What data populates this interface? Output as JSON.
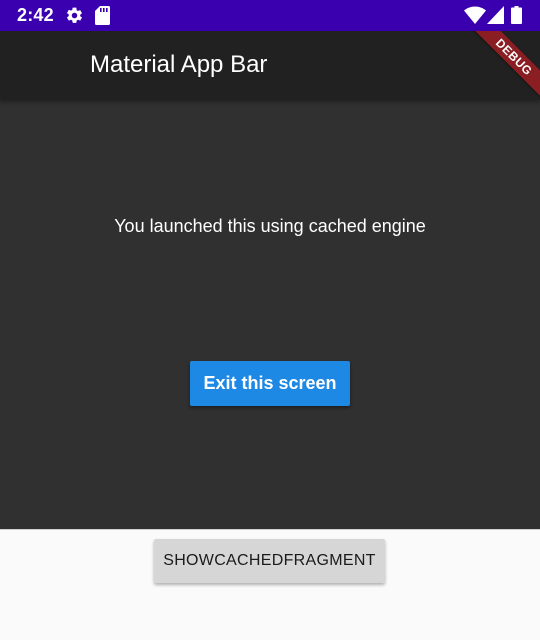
{
  "status_bar": {
    "time": "2:42",
    "background": "#3a00b0",
    "left_icons": [
      "gear-icon",
      "sd-card-icon"
    ],
    "right_icons": [
      "wifi-icon",
      "cell-signal-icon",
      "battery-icon"
    ]
  },
  "app_bar": {
    "title": "Material App Bar",
    "background": "#212121"
  },
  "debug_banner": {
    "label": "DEBUG",
    "color": "#8b1e22"
  },
  "body": {
    "message": "You launched this using cached engine",
    "background": "#303030",
    "exit_button_label": "Exit this screen",
    "exit_button_color": "#1e88e5"
  },
  "native": {
    "button_label": "SHOWCACHEDFRAGMENT",
    "background": "#fafafa"
  }
}
